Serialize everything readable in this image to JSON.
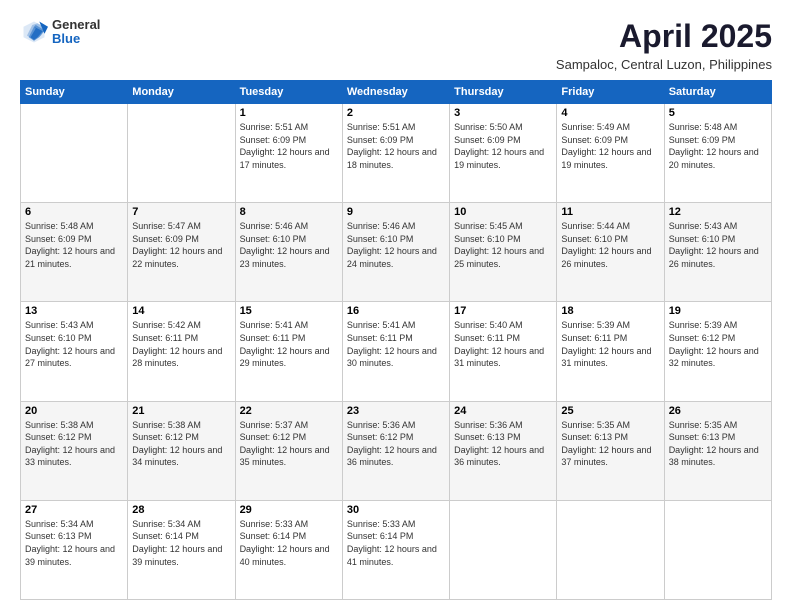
{
  "logo": {
    "general": "General",
    "blue": "Blue"
  },
  "title": "April 2025",
  "subtitle": "Sampaloc, Central Luzon, Philippines",
  "days_header": [
    "Sunday",
    "Monday",
    "Tuesday",
    "Wednesday",
    "Thursday",
    "Friday",
    "Saturday"
  ],
  "weeks": [
    [
      {
        "day": "",
        "info": ""
      },
      {
        "day": "",
        "info": ""
      },
      {
        "day": "1",
        "info": "Sunrise: 5:51 AM\nSunset: 6:09 PM\nDaylight: 12 hours and 17 minutes."
      },
      {
        "day": "2",
        "info": "Sunrise: 5:51 AM\nSunset: 6:09 PM\nDaylight: 12 hours and 18 minutes."
      },
      {
        "day": "3",
        "info": "Sunrise: 5:50 AM\nSunset: 6:09 PM\nDaylight: 12 hours and 19 minutes."
      },
      {
        "day": "4",
        "info": "Sunrise: 5:49 AM\nSunset: 6:09 PM\nDaylight: 12 hours and 19 minutes."
      },
      {
        "day": "5",
        "info": "Sunrise: 5:48 AM\nSunset: 6:09 PM\nDaylight: 12 hours and 20 minutes."
      }
    ],
    [
      {
        "day": "6",
        "info": "Sunrise: 5:48 AM\nSunset: 6:09 PM\nDaylight: 12 hours and 21 minutes."
      },
      {
        "day": "7",
        "info": "Sunrise: 5:47 AM\nSunset: 6:09 PM\nDaylight: 12 hours and 22 minutes."
      },
      {
        "day": "8",
        "info": "Sunrise: 5:46 AM\nSunset: 6:10 PM\nDaylight: 12 hours and 23 minutes."
      },
      {
        "day": "9",
        "info": "Sunrise: 5:46 AM\nSunset: 6:10 PM\nDaylight: 12 hours and 24 minutes."
      },
      {
        "day": "10",
        "info": "Sunrise: 5:45 AM\nSunset: 6:10 PM\nDaylight: 12 hours and 25 minutes."
      },
      {
        "day": "11",
        "info": "Sunrise: 5:44 AM\nSunset: 6:10 PM\nDaylight: 12 hours and 26 minutes."
      },
      {
        "day": "12",
        "info": "Sunrise: 5:43 AM\nSunset: 6:10 PM\nDaylight: 12 hours and 26 minutes."
      }
    ],
    [
      {
        "day": "13",
        "info": "Sunrise: 5:43 AM\nSunset: 6:10 PM\nDaylight: 12 hours and 27 minutes."
      },
      {
        "day": "14",
        "info": "Sunrise: 5:42 AM\nSunset: 6:11 PM\nDaylight: 12 hours and 28 minutes."
      },
      {
        "day": "15",
        "info": "Sunrise: 5:41 AM\nSunset: 6:11 PM\nDaylight: 12 hours and 29 minutes."
      },
      {
        "day": "16",
        "info": "Sunrise: 5:41 AM\nSunset: 6:11 PM\nDaylight: 12 hours and 30 minutes."
      },
      {
        "day": "17",
        "info": "Sunrise: 5:40 AM\nSunset: 6:11 PM\nDaylight: 12 hours and 31 minutes."
      },
      {
        "day": "18",
        "info": "Sunrise: 5:39 AM\nSunset: 6:11 PM\nDaylight: 12 hours and 31 minutes."
      },
      {
        "day": "19",
        "info": "Sunrise: 5:39 AM\nSunset: 6:12 PM\nDaylight: 12 hours and 32 minutes."
      }
    ],
    [
      {
        "day": "20",
        "info": "Sunrise: 5:38 AM\nSunset: 6:12 PM\nDaylight: 12 hours and 33 minutes."
      },
      {
        "day": "21",
        "info": "Sunrise: 5:38 AM\nSunset: 6:12 PM\nDaylight: 12 hours and 34 minutes."
      },
      {
        "day": "22",
        "info": "Sunrise: 5:37 AM\nSunset: 6:12 PM\nDaylight: 12 hours and 35 minutes."
      },
      {
        "day": "23",
        "info": "Sunrise: 5:36 AM\nSunset: 6:12 PM\nDaylight: 12 hours and 36 minutes."
      },
      {
        "day": "24",
        "info": "Sunrise: 5:36 AM\nSunset: 6:13 PM\nDaylight: 12 hours and 36 minutes."
      },
      {
        "day": "25",
        "info": "Sunrise: 5:35 AM\nSunset: 6:13 PM\nDaylight: 12 hours and 37 minutes."
      },
      {
        "day": "26",
        "info": "Sunrise: 5:35 AM\nSunset: 6:13 PM\nDaylight: 12 hours and 38 minutes."
      }
    ],
    [
      {
        "day": "27",
        "info": "Sunrise: 5:34 AM\nSunset: 6:13 PM\nDaylight: 12 hours and 39 minutes."
      },
      {
        "day": "28",
        "info": "Sunrise: 5:34 AM\nSunset: 6:14 PM\nDaylight: 12 hours and 39 minutes."
      },
      {
        "day": "29",
        "info": "Sunrise: 5:33 AM\nSunset: 6:14 PM\nDaylight: 12 hours and 40 minutes."
      },
      {
        "day": "30",
        "info": "Sunrise: 5:33 AM\nSunset: 6:14 PM\nDaylight: 12 hours and 41 minutes."
      },
      {
        "day": "",
        "info": ""
      },
      {
        "day": "",
        "info": ""
      },
      {
        "day": "",
        "info": ""
      }
    ]
  ]
}
